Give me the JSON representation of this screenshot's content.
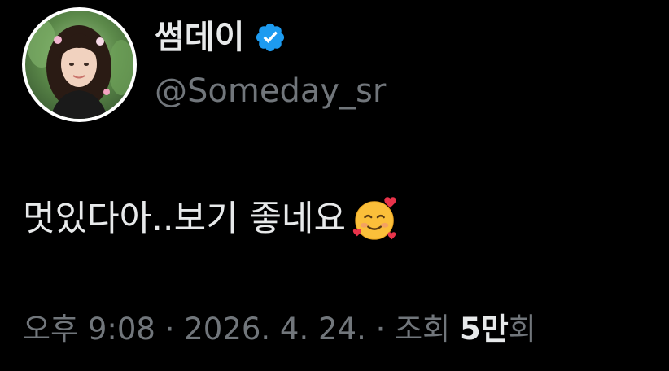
{
  "author": {
    "display_name": "썸데이",
    "handle": "@Someday_sr",
    "verified_icon": "verified-badge-icon",
    "verified_color": "#1d9bf0"
  },
  "tweet": {
    "text": "멋있다아..보기 좋네요",
    "emoji": "smiling-face-with-hearts-icon"
  },
  "meta": {
    "time": "오후 9:08",
    "sep1": " · ",
    "date": "2026. 4. 24.",
    "sep2": " · ",
    "views_label": "조회",
    "views_value": "5만",
    "views_unit": "회"
  },
  "colors": {
    "background": "#000000",
    "primary_text": "#e7e9ea",
    "secondary_text": "#71767b"
  }
}
